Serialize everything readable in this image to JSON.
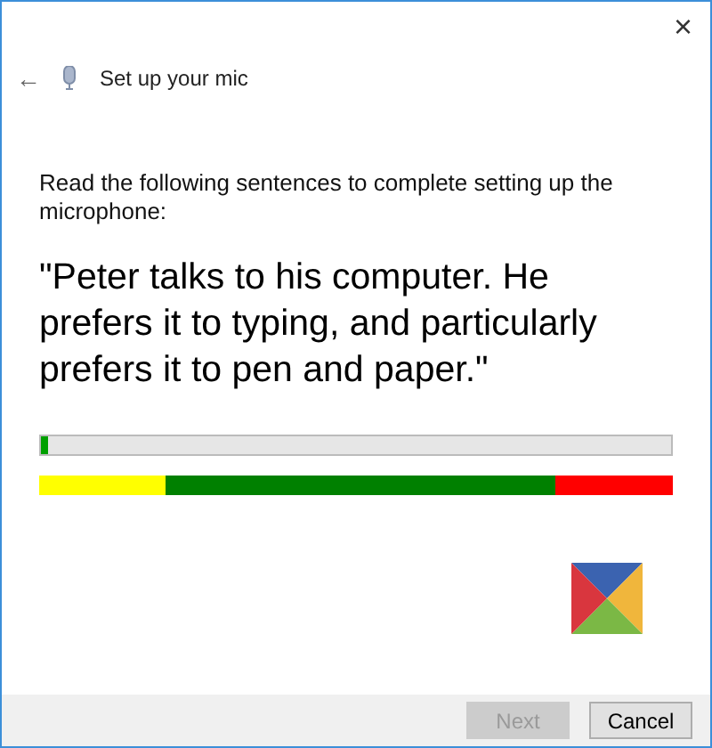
{
  "window": {
    "close": "×",
    "back": "←",
    "title": "Set up your mic"
  },
  "instruction": "Read the following sentences to complete setting up the microphone:",
  "sentence": "\"Peter talks to his computer. He prefers it to typing, and particularly prefers it to pen and paper.\"",
  "meter": {
    "level": 0.01
  },
  "zones": [
    {
      "color": "#ffff00"
    },
    {
      "color": "#008000"
    },
    {
      "color": "#ff0000"
    }
  ],
  "buttons": [
    {
      "label": "Next",
      "disabled": true
    },
    {
      "label": "Cancel",
      "disabled": false
    }
  ]
}
